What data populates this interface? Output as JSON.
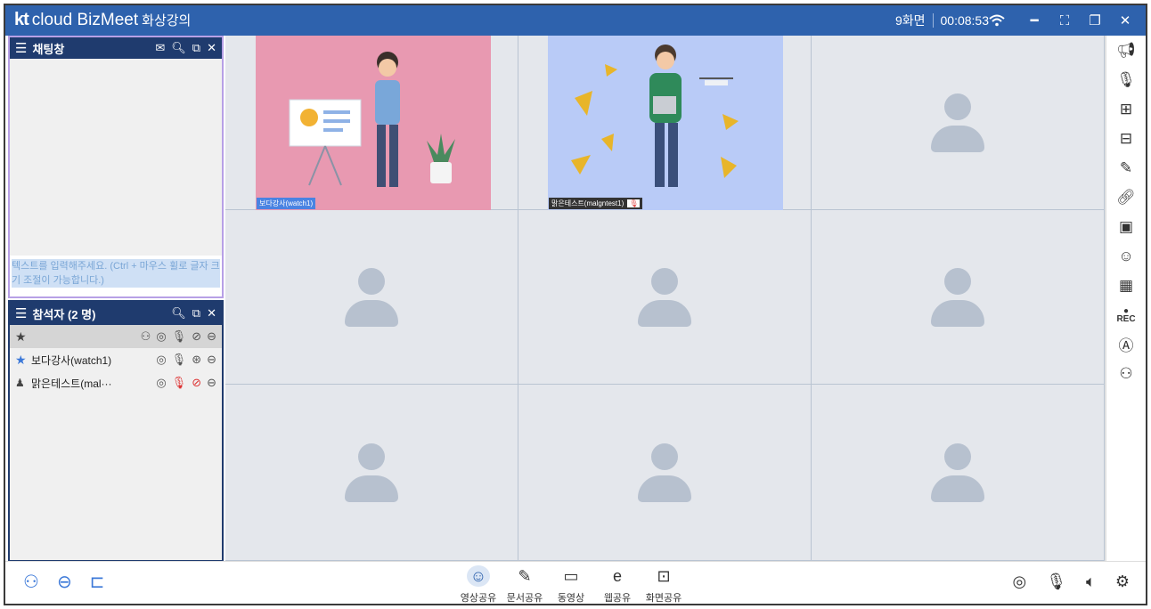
{
  "titlebar": {
    "logo_kt": "kt",
    "logo_brand": "cloud BizMeet",
    "course": "화상강의",
    "layout_label": "9화면",
    "timer": "00:08:53"
  },
  "chat": {
    "title": "채팅창",
    "placeholder": "텍스트를 입력해주세요. (Ctrl + 마우스 휠로 글자 크기 조절이 가능합니다.)"
  },
  "participants": {
    "title": "참석자 (2 명)",
    "rows": [
      {
        "name": "보다강사(watch1)"
      },
      {
        "name": "맑은테스트(mal···"
      }
    ]
  },
  "videos": [
    {
      "label": "보다강사(watch1)"
    },
    {
      "label": "맑은테스트(malgntest1)"
    }
  ],
  "bottom": {
    "center": [
      {
        "label": "영상공유"
      },
      {
        "label": "문서공유"
      },
      {
        "label": "동영상"
      },
      {
        "label": "웹공유"
      },
      {
        "label": "화면공유"
      }
    ]
  },
  "rtools": {
    "rec_label": "REC"
  },
  "colors": {
    "titlebar": "#2e62ad",
    "panel_header": "#1f3b6e",
    "chat_border": "#b7a0e6",
    "accent": "#3b78d8"
  }
}
